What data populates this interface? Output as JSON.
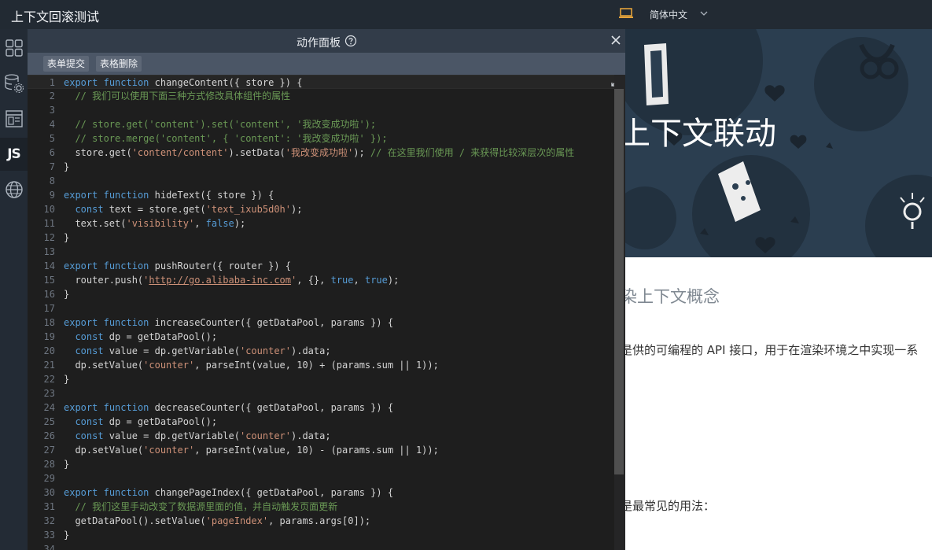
{
  "app": {
    "title": "上下文回滚测试"
  },
  "header": {
    "language": "简体中文",
    "device_icon": "laptop-icon"
  },
  "rail": {
    "items": [
      {
        "icon": "grid-icon"
      },
      {
        "icon": "database-settings-icon"
      },
      {
        "icon": "layout-icon"
      },
      {
        "icon": "js-icon",
        "label": "JS",
        "active": true
      },
      {
        "icon": "globe-icon"
      }
    ]
  },
  "panel": {
    "title": "动作面板",
    "help_icon": "help-icon",
    "close_icon": "close-icon",
    "tabs": [
      {
        "label": "表单提交"
      },
      {
        "label": "表格删除"
      }
    ]
  },
  "editor": {
    "lines": [
      "export function changeContent({ store }) {",
      "  // 我们可以使用下面三种方式修改具体组件的属性",
      "",
      "  // store.get('content').set('content', '我改变成功啦');",
      "  // store.merge('content', { 'content': '我改变成功啦' });",
      "  store.get('content/content').setData('我改变成功啦'); // 在这里我们使用 / 来获得比较深层次的属性",
      "}",
      "",
      "export function hideText({ store }) {",
      "  const text = store.get('text_ixub5d0h');",
      "  text.set('visibility', false);",
      "}",
      "",
      "export function pushRouter({ router }) {",
      "  router.push('http://go.alibaba-inc.com', {}, true, true);",
      "}",
      "",
      "export function increaseCounter({ getDataPool, params }) {",
      "  const dp = getDataPool();",
      "  const value = dp.getVariable('counter').data;",
      "  dp.setValue('counter', parseInt(value, 10) + (params.sum || 1));",
      "}",
      "",
      "export function decreaseCounter({ getDataPool, params }) {",
      "  const dp = getDataPool();",
      "  const value = dp.getVariable('counter').data;",
      "  dp.setValue('counter', parseInt(value, 10) - (params.sum || 1));",
      "}",
      "",
      "export function changePageIndex({ getDataPool, params }) {",
      "  // 我们这里手动改变了数据源里面的值，并自动触发页面更新",
      "  getDataPool().setValue('pageIndex', params.args[0]);",
      "}",
      ""
    ]
  },
  "preview": {
    "hero_title": "上下文联动",
    "sub_heading": "染上下文概念",
    "paragraph": "是供的可编程的 API 接口，用于在渲染环境之中实现一系",
    "usage": "是最常见的用法："
  }
}
